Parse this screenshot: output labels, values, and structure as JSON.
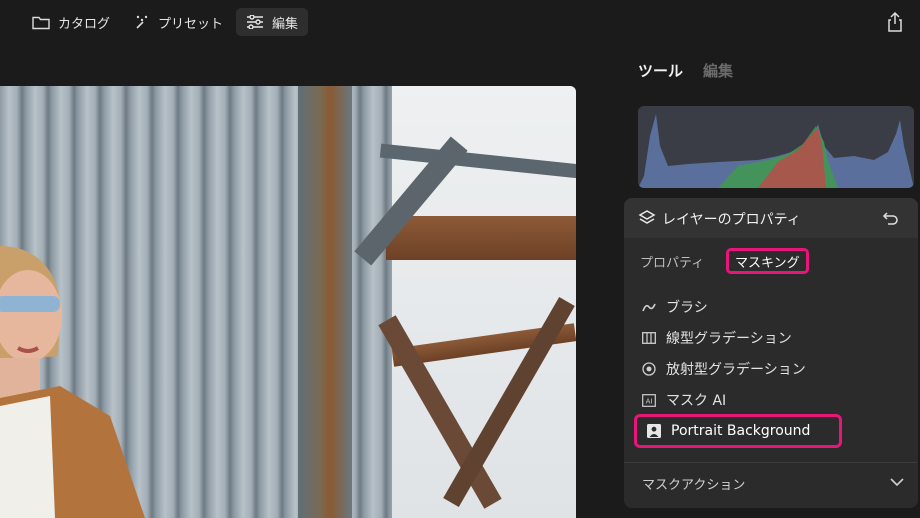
{
  "topbar": {
    "catalog_label": "カタログ",
    "preset_label": "プリセット",
    "edit_label": "編集"
  },
  "panel": {
    "tabs": [
      {
        "label": "ツール",
        "active": true
      },
      {
        "label": "編集",
        "active": false
      }
    ],
    "histogram_colors": {
      "blue": "#5a6f9c",
      "green": "#3f9a4f",
      "red": "#c04a4a"
    }
  },
  "layer_card": {
    "title": "レイヤーのプロパティ",
    "subtabs": [
      {
        "label": "プロパティ",
        "selected": false
      },
      {
        "label": "マスキング",
        "selected": true
      }
    ],
    "mask_items": [
      {
        "label": "ブラシ",
        "icon": "brush-icon"
      },
      {
        "label": "線型グラデーション",
        "icon": "linear-gradient-icon"
      },
      {
        "label": "放射型グラデーション",
        "icon": "radial-gradient-icon"
      },
      {
        "label": "マスク AI",
        "icon": "ai-icon"
      },
      {
        "label": "Portrait Background",
        "icon": "portrait-icon",
        "highlighted": true
      }
    ],
    "mask_actions_label": "マスクアクション"
  },
  "colors": {
    "highlight": "#e8157a",
    "card_bg": "#2b2b2b",
    "app_bg": "#1b1b1b"
  }
}
